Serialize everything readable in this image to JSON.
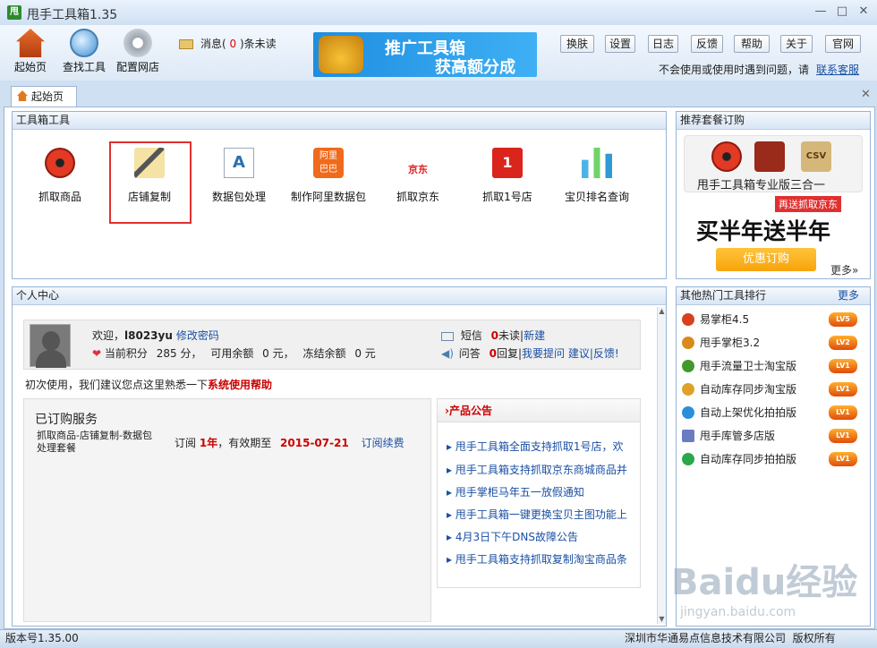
{
  "window": {
    "title": "甩手工具箱1.35",
    "logo": "甩"
  },
  "toolbar": {
    "items": [
      {
        "label": "起始页",
        "icon": "home-icon"
      },
      {
        "label": "查找工具",
        "icon": "magnifier-icon"
      },
      {
        "label": "配置网店",
        "icon": "gear-icon"
      }
    ],
    "message": {
      "prefix": "消息(",
      "count": "0",
      "suffix": ")条未读"
    },
    "banner": {
      "line1": "推广工具箱",
      "line2": "获高额分成"
    },
    "buttons": [
      "换肤",
      "设置",
      "日志",
      "反馈",
      "帮助",
      "关于",
      "官网"
    ],
    "feedback_text": "不会使用或使用时遇到问题，请",
    "feedback_link": "联系客服"
  },
  "tabs": [
    {
      "label": "起始页"
    }
  ],
  "toolbox": {
    "title": "工具箱工具",
    "tools": [
      {
        "label": "抓取商品",
        "icon": "spider-icon"
      },
      {
        "label": "店铺复制",
        "icon": "copy-wand-icon"
      },
      {
        "label": "数据包处理",
        "icon": "font-icon"
      },
      {
        "label": "制作阿里数据包",
        "icon": "alibaba-icon"
      },
      {
        "label": "抓取京东",
        "icon": "jd-icon"
      },
      {
        "label": "抓取1号店",
        "icon": "yhd-icon"
      },
      {
        "label": "宝贝排名查询",
        "icon": "bar-chart-icon"
      }
    ]
  },
  "personal": {
    "title": "个人中心",
    "welcome": "欢迎，",
    "username": "l8023yu",
    "change_pwd": "修改密码",
    "points_label": "当前积分",
    "points": "285",
    "points_unit": "分，",
    "balance_label": "可用余额",
    "balance": "0",
    "balance_unit": "元，",
    "frozen_label": "冻结余额",
    "frozen": "0",
    "frozen_unit": "元",
    "sms_label": "短信",
    "sms_unread": "0",
    "sms_unread_label": "未读",
    "sms_new": "新建",
    "qa_label": "问答",
    "qa_reply": "0",
    "qa_reply_label": "回复",
    "qa_links": "我要提问 建议|反馈!",
    "tip_prefix": "初次使用，我们建议您点这里熟悉一下",
    "tip_link": "系统使用帮助",
    "subscribed_title": "已订购服务",
    "service_name_1": "抓取商品-店铺复制-数据包",
    "service_name_2": "处理套餐",
    "order_prefix": "订阅",
    "order_term": "1年",
    "order_mid": "，有效期至",
    "order_expire": "2015-07-21",
    "order_renew": "订阅续费",
    "notice_title": "产品公告",
    "notices": [
      "甩手工具箱全面支持抓取1号店，欢",
      "甩手工具箱支持抓取京东商城商品并",
      "甩手掌柜马年五一放假通知",
      "甩手工具箱一键更换宝贝主图功能上",
      "4月3日下午DNS故障公告",
      "甩手工具箱支持抓取复制淘宝商品条"
    ]
  },
  "recommend": {
    "title": "推荐套餐订购",
    "product": "甩手工具箱专业版三合一",
    "ribbon": "再送抓取京东",
    "slogan": "买半年送半年",
    "button": "优惠订购",
    "more": "更多»",
    "icon_labels": [
      "甩手\n店铺复制",
      "CSV"
    ]
  },
  "hot": {
    "title": "其他热门工具排行",
    "more": "更多",
    "items": [
      {
        "label": "易掌柜4.5",
        "badge": "LV5",
        "color": "#d8401e"
      },
      {
        "label": "甩手掌柜3.2",
        "badge": "LV2",
        "color": "#d88a1e"
      },
      {
        "label": "甩手流量卫士淘宝版",
        "badge": "LV1",
        "color": "#3f9a2a"
      },
      {
        "label": "自动库存同步淘宝版",
        "badge": "LV1",
        "color": "#e0a12a"
      },
      {
        "label": "自动上架优化拍拍版",
        "badge": "LV1",
        "color": "#2a8fd8"
      },
      {
        "label": "甩手库管多店版",
        "badge": "LV1",
        "color": "#6a7cc0"
      },
      {
        "label": "自动库存同步拍拍版",
        "badge": "LV1",
        "color": "#2aa84a"
      }
    ]
  },
  "status": {
    "version": "版本号1.35.00",
    "company": "深圳市华通易点信息技术有限公司  版权所有"
  },
  "watermark": {
    "brand": "Baidu经验",
    "url": "jingyan.baidu.com"
  }
}
